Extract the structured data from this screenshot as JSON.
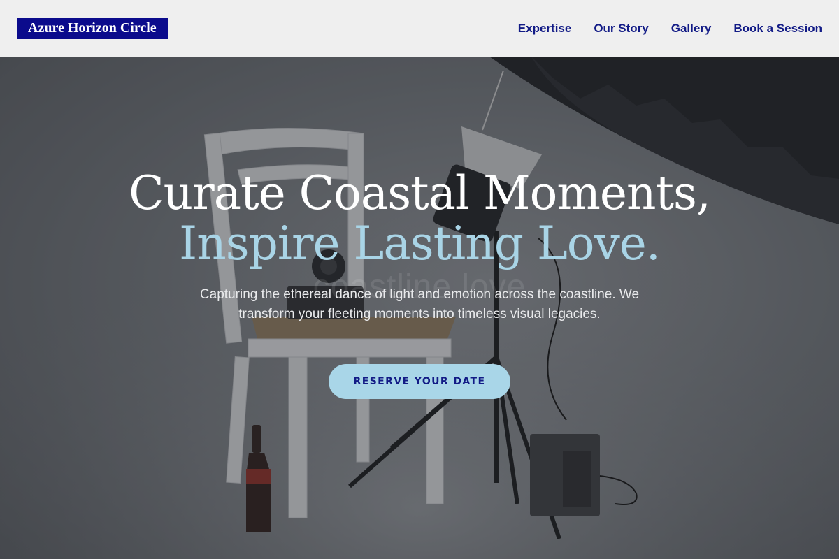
{
  "brand": {
    "name": "Azure Horizon Circle"
  },
  "nav": {
    "items": [
      {
        "label": "Expertise"
      },
      {
        "label": "Our Story"
      },
      {
        "label": "Gallery"
      },
      {
        "label": "Book a Session"
      }
    ]
  },
  "hero": {
    "headline_line1": "Curate Coastal Moments,",
    "headline_line2": "Inspire Lasting Love.",
    "watermark": "coastline love",
    "subtitle": "Capturing the ethereal dance of light and emotion across the coastline. We transform your fleeting moments into timeless visual legacies.",
    "cta_label": "RESERVE YOUR DATE"
  },
  "colors": {
    "brand_bg": "#0b0b8c",
    "nav_text": "#121b86",
    "accent": "#a9d6e8",
    "header_bg": "#efefef"
  }
}
